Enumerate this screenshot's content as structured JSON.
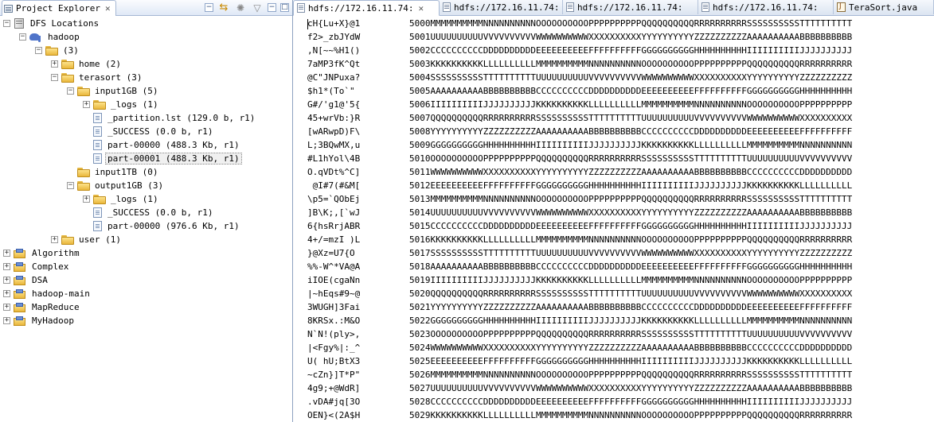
{
  "project_explorer": {
    "title": "Project Explorer",
    "tree": [
      {
        "depth": 0,
        "expander": "minus",
        "icon": "dfs",
        "label": "DFS Locations"
      },
      {
        "depth": 1,
        "expander": "minus",
        "icon": "elephant",
        "label": "hadoop"
      },
      {
        "depth": 2,
        "expander": "minus",
        "icon": "folder",
        "label": " (3)"
      },
      {
        "depth": 3,
        "expander": "plus",
        "icon": "folder",
        "label": "home (2)"
      },
      {
        "depth": 3,
        "expander": "minus",
        "icon": "folder",
        "label": "terasort (3)"
      },
      {
        "depth": 4,
        "expander": "minus",
        "icon": "folder",
        "label": "input1GB (5)"
      },
      {
        "depth": 5,
        "expander": "plus",
        "icon": "folder",
        "label": "_logs (1)"
      },
      {
        "depth": 5,
        "expander": "none",
        "icon": "file",
        "label": "_partition.lst (129.0 b, r1)"
      },
      {
        "depth": 5,
        "expander": "none",
        "icon": "file",
        "label": "_SUCCESS (0.0 b, r1)"
      },
      {
        "depth": 5,
        "expander": "none",
        "icon": "file",
        "label": "part-00000 (488.3 Kb, r1)"
      },
      {
        "depth": 5,
        "expander": "none",
        "icon": "file",
        "label": "part-00001 (488.3 Kb, r1)",
        "selected": true
      },
      {
        "depth": 4,
        "expander": "none",
        "icon": "folder",
        "label": "input1TB (0)"
      },
      {
        "depth": 4,
        "expander": "minus",
        "icon": "folder",
        "label": "output1GB (3)"
      },
      {
        "depth": 5,
        "expander": "plus",
        "icon": "folder",
        "label": "_logs (1)"
      },
      {
        "depth": 5,
        "expander": "none",
        "icon": "file",
        "label": "_SUCCESS (0.0 b, r1)"
      },
      {
        "depth": 5,
        "expander": "none",
        "icon": "file",
        "label": "part-00000 (976.6 Kb, r1)"
      },
      {
        "depth": 3,
        "expander": "plus",
        "icon": "folder",
        "label": "user (1)"
      },
      {
        "depth": 0,
        "expander": "plus",
        "icon": "project",
        "label": "Algorithm"
      },
      {
        "depth": 0,
        "expander": "plus",
        "icon": "project",
        "label": "Complex"
      },
      {
        "depth": 0,
        "expander": "plus",
        "icon": "project",
        "label": "DSA"
      },
      {
        "depth": 0,
        "expander": "plus",
        "icon": "project",
        "label": "hadoop-main"
      },
      {
        "depth": 0,
        "expander": "plus",
        "icon": "project",
        "label": "MapReduce"
      },
      {
        "depth": 0,
        "expander": "plus",
        "icon": "project",
        "label": "MyHadoop"
      }
    ]
  },
  "editor_tabs": [
    {
      "label": "hdfs://172.16.11.74:",
      "icon": "doc",
      "active": true,
      "close": "✕"
    },
    {
      "label": "hdfs://172.16.11.74:",
      "icon": "doc",
      "active": false
    },
    {
      "label": "hdfs://172.16.11.74:",
      "icon": "doc",
      "active": false
    },
    {
      "label": "hdfs://172.16.11.74:",
      "icon": "doc",
      "active": false
    },
    {
      "label": "TeraSort.java",
      "icon": "java",
      "active": false
    }
  ],
  "editor_lines": [
    {
      "key": "cH{Lu+X}@1",
      "value": "5000MMMMMMMMMMNNNNNNNNNNOOOOOOOOOOPPPPPPPPPPQQQQQQQQQQRRRRRRRRRRSSSSSSSSSSTTTTTTTTTT"
    },
    {
      "key": "f2>_zbJYdW",
      "value": "5001UUUUUUUUUUVVVVVVVVVVWWWWWWWWWWXXXXXXXXXXYYYYYYYYYYZZZZZZZZZZAAAAAAAAAABBBBBBBBBB"
    },
    {
      "key": ",N[~~%H1()",
      "value": "5002CCCCCCCCCCDDDDDDDDDDEEEEEEEEEEFFFFFFFFFFGGGGGGGGGGHHHHHHHHHHIIIIIIIIIIJJJJJJJJJJ"
    },
    {
      "key": "7aMP3fK^Qt",
      "value": "5003KKKKKKKKKKLLLLLLLLLLMMMMMMMMMMNNNNNNNNNNOOOOOOOOOOPPPPPPPPPPQQQQQQQQQQRRRRRRRRRR"
    },
    {
      "key": "@C\"JNPuxa?",
      "value": "5004SSSSSSSSSSTTTTTTTTTTUUUUUUUUUUVVVVVVVVVVWWWWWWWWWWXXXXXXXXXXYYYYYYYYYYZZZZZZZZZZ"
    },
    {
      "key": "$h1*(To`\"",
      "value": "5005AAAAAAAAAABBBBBBBBBBCCCCCCCCCCDDDDDDDDDDEEEEEEEEEEFFFFFFFFFFGGGGGGGGGGHHHHHHHHHH"
    },
    {
      "key": "G#/'g1@'5{",
      "value": "5006IIIIIIIIIIJJJJJJJJJJKKKKKKKKKKLLLLLLLLLLMMMMMMMMMMNNNNNNNNNNOOOOOOOOOOPPPPPPPPPP"
    },
    {
      "key": "45+wrVb:}R",
      "value": "5007QQQQQQQQQQRRRRRRRRRRSSSSSSSSSSTTTTTTTTTTUUUUUUUUUUVVVVVVVVVVWWWWWWWWWWXXXXXXXXXX"
    },
    {
      "key": "[wARwpD)F\\",
      "value": "5008YYYYYYYYYYZZZZZZZZZZAAAAAAAAAABBBBBBBBBBCCCCCCCCCCDDDDDDDDDDEEEEEEEEEEFFFFFFFFFF"
    },
    {
      "key": "L;3BQwMX,u",
      "value": "5009GGGGGGGGGGHHHHHHHHHHIIIIIIIIIIJJJJJJJJJJKKKKKKKKKKLLLLLLLLLLMMMMMMMMMMNNNNNNNNNN"
    },
    {
      "key": "#L1hYol\\4B",
      "value": "5010OOOOOOOOOOPPPPPPPPPPQQQQQQQQQQRRRRRRRRRRSSSSSSSSSSTTTTTTTTTTUUUUUUUUUUVVVVVVVVVV"
    },
    {
      "key": "O.qVDt%^C]",
      "value": "5011WWWWWWWWWWXXXXXXXXXXYYYYYYYYYYZZZZZZZZZZAAAAAAAAAABBBBBBBBBBCCCCCCCCCCDDDDDDDDDD"
    },
    {
      "key": " @I#7(#&M[",
      "value": "5012EEEEEEEEEEFFFFFFFFFFGGGGGGGGGGHHHHHHHHHHIIIIIIIIIIJJJJJJJJJJKKKKKKKKKKLLLLLLLLLL"
    },
    {
      "key": "\\p5=`QObEj",
      "value": "5013MMMMMMMMMMNNNNNNNNNNOOOOOOOOOOPPPPPPPPPPQQQQQQQQQQRRRRRRRRRRSSSSSSSSSSTTTTTTTTTT"
    },
    {
      "key": "]B\\K;,[`wJ",
      "value": "5014UUUUUUUUUUVVVVVVVVVVWWWWWWWWWWXXXXXXXXXXYYYYYYYYYYZZZZZZZZZZAAAAAAAAAABBBBBBBBBB"
    },
    {
      "key": "6{hsRrjABR",
      "value": "5015CCCCCCCCCCDDDDDDDDDDEEEEEEEEEEFFFFFFFFFFGGGGGGGGGGHHHHHHHHHHIIIIIIIIIIJJJJJJJJJJ"
    },
    {
      "key": "4+/=mzI )L",
      "value": "5016KKKKKKKKKKLLLLLLLLLLMMMMMMMMMMNNNNNNNNNNOOOOOOOOOOPPPPPPPPPPQQQQQQQQQQRRRRRRRRRR"
    },
    {
      "key": "}@Xz=U7{O",
      "value": "5017SSSSSSSSSSTTTTTTTTTTUUUUUUUUUUVVVVVVVVVVWWWWWWWWWWXXXXXXXXXXYYYYYYYYYYZZZZZZZZZZ"
    },
    {
      "key": "%%-W^*VA@A",
      "value": "5018AAAAAAAAAABBBBBBBBBBCCCCCCCCCCDDDDDDDDDDEEEEEEEEEEFFFFFFFFFFGGGGGGGGGGHHHHHHHHHH"
    },
    {
      "key": "iIOE(cgaNn",
      "value": "5019IIIIIIIIIIJJJJJJJJJJKKKKKKKKKKLLLLLLLLLLMMMMMMMMMMNNNNNNNNNNOOOOOOOOOOPPPPPPPPPP"
    },
    {
      "key": "|~hEqs#9~@",
      "value": "5020QQQQQQQQQQRRRRRRRRRRSSSSSSSSSSTTTTTTTTTTUUUUUUUUUUVVVVVVVVVVWWWWWWWWWWXXXXXXXXXX"
    },
    {
      "key": "3WUGH]3Fai",
      "value": "5021YYYYYYYYYYZZZZZZZZZZAAAAAAAAAABBBBBBBBBBCCCCCCCCCCDDDDDDDDDDEEEEEEEEEEFFFFFFFFFF"
    },
    {
      "key": "8KRSx.:M&O",
      "value": "5022GGGGGGGGGGHHHHHHHHHHIIIIIIIIIIJJJJJJJJJJKKKKKKKKKKLLLLLLLLLLMMMMMMMMMMNNNNNNNNNN"
    },
    {
      "key": "N`N!(ply>,",
      "value": "5023OOOOOOOOOOPPPPPPPPPPQQQQQQQQQQRRRRRRRRRRSSSSSSSSSSTTTTTTTTTTUUUUUUUUUUVVVVVVVVVV"
    },
    {
      "key": "|<Fgy%|:_^",
      "value": "5024WWWWWWWWWWXXXXXXXXXXYYYYYYYYYYZZZZZZZZZZAAAAAAAAAABBBBBBBBBBCCCCCCCCCCDDDDDDDDDD"
    },
    {
      "key": "U( hU;BtX3",
      "value": "5025EEEEEEEEEEFFFFFFFFFFGGGGGGGGGGHHHHHHHHHHIIIIIIIIIIJJJJJJJJJJKKKKKKKKKKLLLLLLLLLL"
    },
    {
      "key": "~cZn}]T*P\"",
      "value": "5026MMMMMMMMMMNNNNNNNNNNOOOOOOOOOOPPPPPPPPPPQQQQQQQQQQRRRRRRRRRRSSSSSSSSSSTTTTTTTTTT"
    },
    {
      "key": "4g9;+@WdR]",
      "value": "5027UUUUUUUUUUVVVVVVVVVVWWWWWWWWWWXXXXXXXXXXYYYYYYYYYYZZZZZZZZZZAAAAAAAAAABBBBBBBBBB"
    },
    {
      "key": ".vDA#jq[3O",
      "value": "5028CCCCCCCCCCDDDDDDDDDDEEEEEEEEEEFFFFFFFFFFGGGGGGGGGGHHHHHHHHHHIIIIIIIIIIJJJJJJJJJJ"
    },
    {
      "key": "OEN}<(2A$H",
      "value": "5029KKKKKKKKKKLLLLLLLLLLMMMMMMMMMMNNNNNNNNNNOOOOOOOOOOPPPPPPPPPPQQQQQQQQQQRRRRRRRRRR"
    }
  ],
  "colors": {
    "accent": "#a6b8d4",
    "selection": "#f0f0f0",
    "folder": "#e9b73c",
    "hadoop": "#4f74c9"
  }
}
